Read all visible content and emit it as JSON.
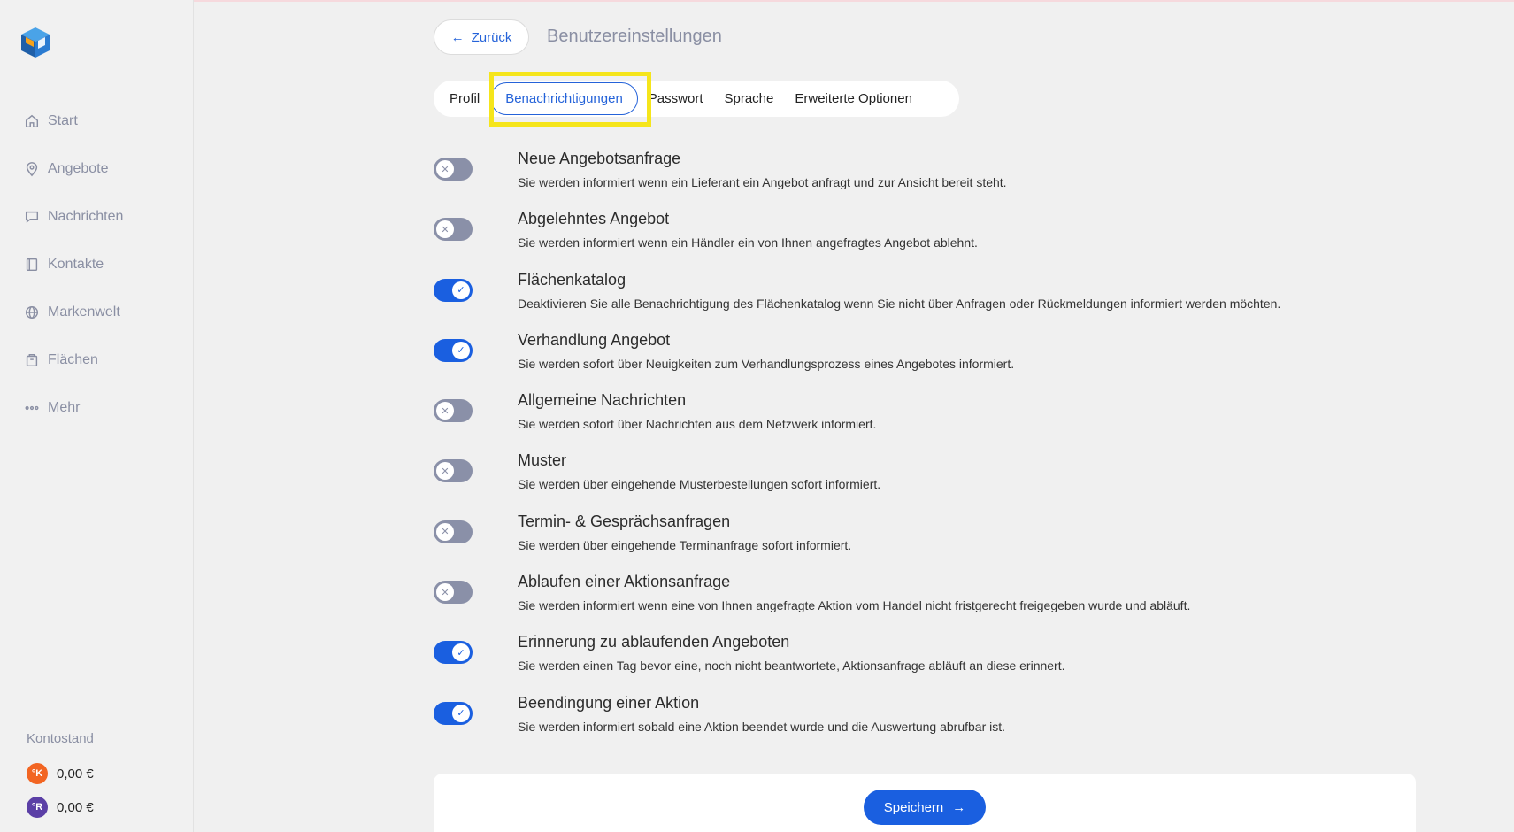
{
  "sidebar": {
    "items": [
      {
        "label": "Start",
        "icon": "home-icon"
      },
      {
        "label": "Angebote",
        "icon": "location-pin-icon"
      },
      {
        "label": "Nachrichten",
        "icon": "chat-icon"
      },
      {
        "label": "Kontakte",
        "icon": "address-book-icon"
      },
      {
        "label": "Markenwelt",
        "icon": "globe-icon"
      },
      {
        "label": "Flächen",
        "icon": "store-icon"
      },
      {
        "label": "Mehr",
        "icon": "more-dots-icon"
      }
    ],
    "balance_label": "Kontostand",
    "balances": [
      {
        "badge": "°K",
        "value": "0,00 €",
        "color": "#f26522"
      },
      {
        "badge": "°R",
        "value": "0,00 €",
        "color": "#5b3fa6"
      }
    ]
  },
  "header": {
    "back_label": "Zurück",
    "title": "Benutzereinstellungen"
  },
  "tabs": [
    {
      "label": "Profil",
      "active": false
    },
    {
      "label": "Benachrichtigungen",
      "active": true
    },
    {
      "label": "Passwort",
      "active": false
    },
    {
      "label": "Sprache",
      "active": false
    },
    {
      "label": "Erweiterte Optionen",
      "active": false
    }
  ],
  "settings": [
    {
      "title": "Neue Angebotsanfrage",
      "desc": "Sie werden informiert wenn ein Lieferant ein Angebot anfragt und zur Ansicht bereit steht.",
      "on": false
    },
    {
      "title": "Abgelehntes Angebot",
      "desc": "Sie werden informiert wenn ein Händler ein von Ihnen angefragtes Angebot ablehnt.",
      "on": false
    },
    {
      "title": "Flächenkatalog",
      "desc": "Deaktivieren Sie alle Benachrichtigung des Flächenkatalog wenn Sie nicht über Anfragen oder Rückmeldungen informiert werden möchten.",
      "on": true
    },
    {
      "title": "Verhandlung Angebot",
      "desc": "Sie werden sofort über Neuigkeiten zum Verhandlungsprozess eines Angebotes informiert.",
      "on": true
    },
    {
      "title": "Allgemeine Nachrichten",
      "desc": "Sie werden sofort über Nachrichten aus dem Netzwerk informiert.",
      "on": false
    },
    {
      "title": "Muster",
      "desc": "Sie werden über eingehende Musterbestellungen sofort informiert.",
      "on": false
    },
    {
      "title": "Termin- & Gesprächsanfragen",
      "desc": "Sie werden über eingehende Terminanfrage sofort informiert.",
      "on": false
    },
    {
      "title": "Ablaufen einer Aktionsanfrage",
      "desc": "Sie werden informiert wenn eine von Ihnen angefragte Aktion vom Handel nicht fristgerecht freigegeben wurde und abläuft.",
      "on": false
    },
    {
      "title": "Erinnerung zu ablaufenden Angeboten",
      "desc": "Sie werden einen Tag bevor eine, noch nicht beantwortete, Aktionsanfrage abläuft an diese erinnert.",
      "on": true
    },
    {
      "title": "Beendingung einer Aktion",
      "desc": "Sie werden informiert sobald eine Aktion beendet wurde und die Auswertung abrufbar ist.",
      "on": true
    }
  ],
  "footer": {
    "save_label": "Speichern"
  },
  "colors": {
    "accent": "#1a5fe0",
    "highlight": "#f5e51b",
    "toggle_off": "#8a90a8"
  }
}
